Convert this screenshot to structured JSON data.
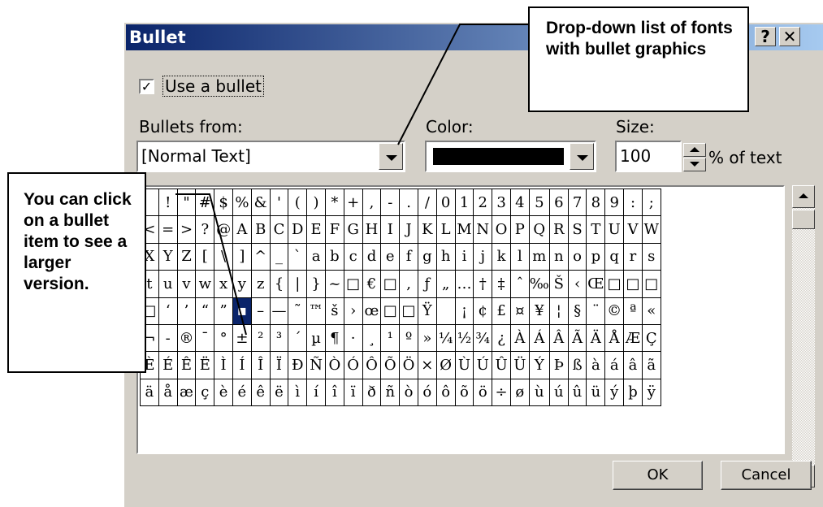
{
  "dialog": {
    "title": "Bullet",
    "help_label": "?",
    "close_label": "✕",
    "use_bullet_label": "Use a bullet",
    "use_bullet_checked": true,
    "bullets_from_label": "Bullets from:",
    "bullets_from_value": "[Normal Text]",
    "color_label": "Color:",
    "color_value": "#000000",
    "size_label": "Size:",
    "size_value": "100",
    "size_suffix": "% of text",
    "ok_label": "OK",
    "cancel_label": "Cancel",
    "grid_rows": [
      [
        " ",
        "!",
        "\"",
        "#",
        "$",
        "%",
        "&",
        "'",
        "(",
        ")",
        "*",
        "+",
        ",",
        "-",
        ".",
        "/",
        "0",
        "1",
        "2",
        "3",
        "4",
        "5",
        "6",
        "7",
        "8",
        "9",
        ":",
        ";"
      ],
      [
        "<",
        "=",
        ">",
        "?",
        "@",
        "A",
        "B",
        "C",
        "D",
        "E",
        "F",
        "G",
        "H",
        "I",
        "J",
        "K",
        "L",
        "M",
        "N",
        "O",
        "P",
        "Q",
        "R",
        "S",
        "T",
        "U",
        "V",
        "W"
      ],
      [
        "X",
        "Y",
        "Z",
        "[",
        "\\",
        "]",
        "^",
        "_",
        "`",
        "a",
        "b",
        "c",
        "d",
        "e",
        "f",
        "g",
        "h",
        "i",
        "j",
        "k",
        "l",
        "m",
        "n",
        "o",
        "p",
        "q",
        "r",
        "s"
      ],
      [
        "t",
        "u",
        "v",
        "w",
        "x",
        "y",
        "z",
        "{",
        "|",
        "}",
        "~",
        "□",
        "€",
        "□",
        ",",
        "ƒ",
        "„",
        "…",
        "†",
        "‡",
        "ˆ",
        "‰",
        "Š",
        "‹",
        "Œ",
        "□",
        "□",
        "□"
      ],
      [
        "□",
        "‘",
        "’",
        "“",
        "”",
        "▪",
        "–",
        "—",
        "˜",
        "™",
        "š",
        "›",
        "œ",
        "□",
        "□",
        "Ÿ",
        " ",
        "¡",
        "¢",
        "£",
        "¤",
        "¥",
        "¦",
        "§",
        "¨",
        "©",
        "ª",
        "«"
      ],
      [
        "¬",
        "-",
        "®",
        "¯",
        "°",
        "±",
        "²",
        "³",
        "´",
        "µ",
        "¶",
        "·",
        "¸",
        "¹",
        "º",
        "»",
        "¼",
        "½",
        "¾",
        "¿",
        "À",
        "Á",
        "Â",
        "Ã",
        "Ä",
        "Å",
        "Æ",
        "Ç"
      ],
      [
        "È",
        "É",
        "Ê",
        "Ë",
        "Ì",
        "Í",
        "Î",
        "Ï",
        "Ð",
        "Ñ",
        "Ò",
        "Ó",
        "Ô",
        "Õ",
        "Ö",
        "×",
        "Ø",
        "Ù",
        "Ú",
        "Û",
        "Ü",
        "Ý",
        "Þ",
        "ß",
        "à",
        "á",
        "â",
        "ã"
      ],
      [
        "ä",
        "å",
        "æ",
        "ç",
        "è",
        "é",
        "ê",
        "ë",
        "ì",
        "í",
        "î",
        "ï",
        "ð",
        "ñ",
        "ò",
        "ó",
        "ô",
        "õ",
        "ö",
        "÷",
        "ø",
        "ù",
        "ú",
        "û",
        "ü",
        "ý",
        "þ",
        "ÿ"
      ]
    ],
    "selected_cell": [
      4,
      5
    ]
  },
  "callouts": {
    "fonts_dropdown": "Drop-down list of fonts with bullet graphics",
    "click_bullet": "You can click on a bullet item to see a larger version."
  }
}
